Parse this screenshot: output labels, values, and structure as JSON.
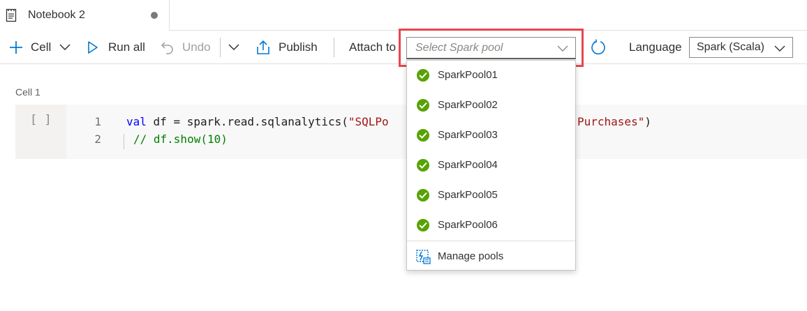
{
  "tab": {
    "title": "Notebook 2"
  },
  "toolbar": {
    "cell_label": "Cell",
    "run_all_label": "Run all",
    "undo_label": "Undo",
    "publish_label": "Publish",
    "attach_to_label": "Attach to",
    "pool_placeholder": "Select Spark pool",
    "language_label": "Language",
    "language_value": "Spark (Scala)"
  },
  "cell": {
    "label": "Cell 1",
    "run_indicator": "[ ]",
    "lines": [
      {
        "num": "1",
        "kw": "val",
        "rest": " df = spark.read.sqlanalytics(",
        "str_a": "\"SQLPo",
        "str_b": "Purchases\"",
        "close": ")"
      },
      {
        "num": "2",
        "comment": "// df.show(10)"
      }
    ]
  },
  "dropdown": {
    "items": [
      "SparkPool01",
      "SparkPool02",
      "SparkPool03",
      "SparkPool04",
      "SparkPool05",
      "SparkPool06"
    ],
    "manage_label": "Manage pools"
  },
  "colors": {
    "accent": "#0078d4",
    "check_green": "#57a300",
    "highlight_red": "#e8464e"
  }
}
